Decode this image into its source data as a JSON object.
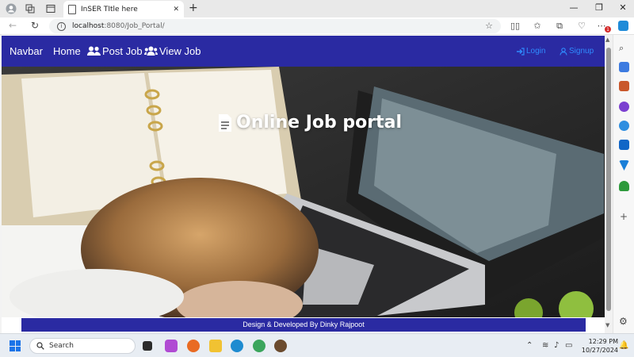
{
  "browser": {
    "tab_title": "InSER TItle here",
    "url_host": "localhost",
    "url_rest": ":8080/Job_Portal/",
    "notification_count": "1"
  },
  "page": {
    "navbar": {
      "brand": "Navbar",
      "links": [
        {
          "label": "Home",
          "icon": "none"
        },
        {
          "label": "Post Job",
          "icon": "users-icon"
        },
        {
          "label": "View Job",
          "icon": "user-group-icon"
        }
      ],
      "login_label": "Login",
      "signup_label": "Signup",
      "bg_color": "#2a2aa2",
      "link_color": "#2f8cff"
    },
    "hero": {
      "title": "Online Job portal",
      "title_icon": "file-icon"
    },
    "footer": {
      "text": "Design & Developed By Dinky Rajpoot"
    }
  },
  "taskbar": {
    "search_placeholder": "Search",
    "time": "12:29 PM",
    "date": "10/27/2024"
  }
}
